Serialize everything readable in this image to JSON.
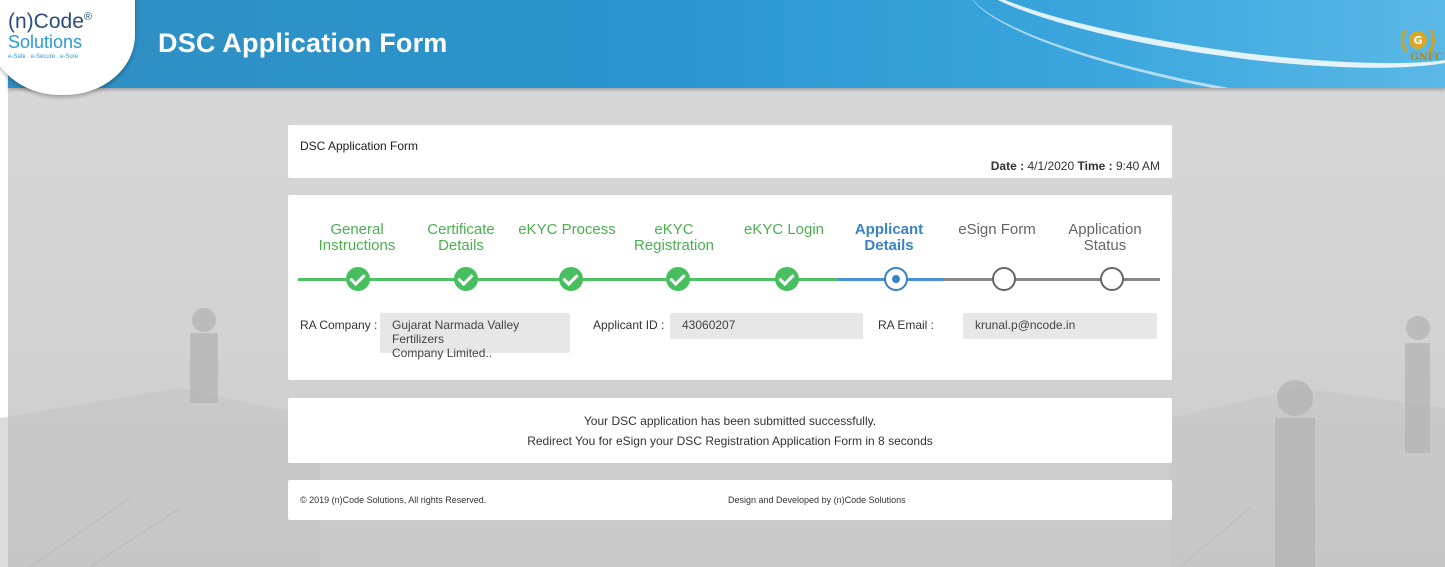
{
  "header": {
    "logo_main": "(n)Code",
    "logo_reg": "®",
    "logo_sub": "Solutions",
    "logo_tagline": "e-Safe . e-Secure . e-Sure",
    "title": "DSC Application Form",
    "partner_logo_text": "GNFC",
    "partner_logo_letter": "G"
  },
  "form_header": {
    "title": "DSC Application Form",
    "date_label": "Date :",
    "date_value": "4/1/2020",
    "time_label": "Time :",
    "time_value": "9:40 AM"
  },
  "steps": [
    {
      "line1": "General",
      "line2": "Instructions",
      "status": "done"
    },
    {
      "line1": "Certificate",
      "line2": "Details",
      "status": "done"
    },
    {
      "line1": "eKYC Process",
      "line2": "",
      "status": "done"
    },
    {
      "line1": "eKYC",
      "line2": "Registration",
      "status": "done"
    },
    {
      "line1": "eKYC Login",
      "line2": "",
      "status": "done"
    },
    {
      "line1": "Applicant",
      "line2": "Details",
      "status": "current"
    },
    {
      "line1": "eSign Form",
      "line2": "",
      "status": "pending"
    },
    {
      "line1": "Application",
      "line2": "Status",
      "status": "pending"
    }
  ],
  "fields": {
    "ra_company_label": "RA Company :",
    "ra_company_value_line1": "Gujarat Narmada Valley Fertilizers",
    "ra_company_value_line2": "Company Limited..",
    "applicant_id_label": "Applicant ID :",
    "applicant_id_value": "43060207",
    "ra_email_label": "RA Email :",
    "ra_email_value": "krunal.p@ncode.in"
  },
  "message": {
    "line1": "Your DSC application has been submitted successfully.",
    "line2": "Redirect You for eSign your DSC Registration Application Form in 8 seconds"
  },
  "footer": {
    "copyright": "© 2019 (n)Code Solutions, All rights Reserved.",
    "credit": "Design and Developed by (n)Code Solutions"
  },
  "colors": {
    "header_blue": "#2a95cf",
    "done_green": "#4cc463",
    "current_blue": "#3a82c4",
    "pending_gray": "#888888"
  }
}
